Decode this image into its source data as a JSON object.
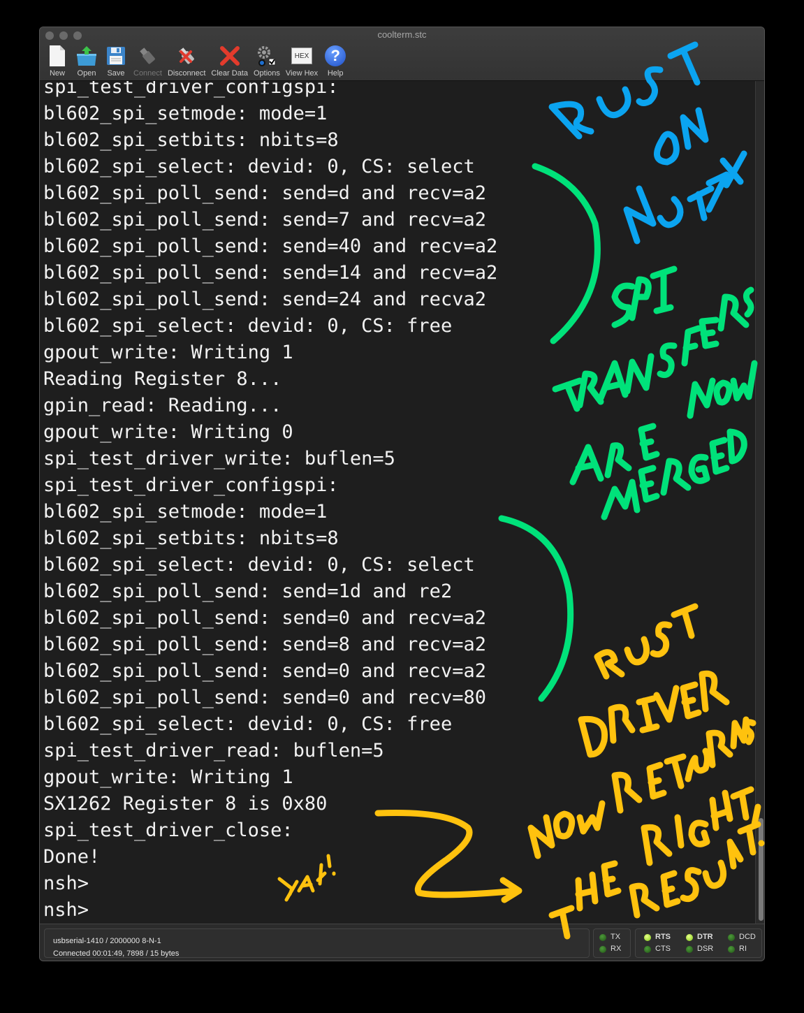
{
  "window": {
    "title": "coolterm.stc"
  },
  "toolbar": {
    "items": [
      {
        "label": "New",
        "icon": "new-file-icon",
        "enabled": true
      },
      {
        "label": "Open",
        "icon": "open-folder-icon",
        "enabled": true
      },
      {
        "label": "Save",
        "icon": "floppy-disk-icon",
        "enabled": true
      },
      {
        "label": "Connect",
        "icon": "usb-plug-icon",
        "enabled": false
      },
      {
        "label": "Disconnect",
        "icon": "disconnect-plug-icon",
        "enabled": true
      },
      {
        "label": "Clear Data",
        "icon": "red-x-icon",
        "enabled": true
      },
      {
        "label": "Options",
        "icon": "gears-icon",
        "enabled": true
      },
      {
        "label": "View Hex",
        "icon": "hex-icon",
        "enabled": true
      },
      {
        "label": "Help",
        "icon": "question-mark-icon",
        "enabled": true
      }
    ],
    "hex_glyph": "HEX",
    "help_glyph": "?"
  },
  "terminal": {
    "lines": [
      "spi_test_driver_configspi:",
      "bl602_spi_setmode: mode=1",
      "bl602_spi_setbits: nbits=8",
      "bl602_spi_select: devid: 0, CS: select",
      "bl602_spi_poll_send: send=d and recv=a2",
      "bl602_spi_poll_send: send=7 and recv=a2",
      "bl602_spi_poll_send: send=40 and recv=a2",
      "bl602_spi_poll_send: send=14 and recv=a2",
      "bl602_spi_poll_send: send=24 and recva2",
      "bl602_spi_select: devid: 0, CS: free",
      "gpout_write: Writing 1",
      "Reading Register 8...",
      "gpin_read: Reading...",
      "gpout_write: Writing 0",
      "spi_test_driver_write: buflen=5",
      "spi_test_driver_configspi:",
      "bl602_spi_setmode: mode=1",
      "bl602_spi_setbits: nbits=8",
      "bl602_spi_select: devid: 0, CS: select",
      "bl602_spi_poll_send: send=1d and re2",
      "bl602_spi_poll_send: send=0 and recv=a2",
      "bl602_spi_poll_send: send=8 and recv=a2",
      "bl602_spi_poll_send: send=0 and recv=a2",
      "bl602_spi_poll_send: send=0 and recv=80",
      "bl602_spi_select: devid: 0, CS: free",
      "spi_test_driver_read: buflen=5",
      "gpout_write: Writing 1",
      "SX1262 Register 8 is 0x80",
      "spi_test_driver_close:",
      "Done!",
      "nsh>",
      "nsh>"
    ],
    "scroll_position_fraction": 1.0
  },
  "status": {
    "port_settings": "usbserial-1410 / 2000000 8-N-1",
    "connection": "Connected 00:01:49, 7898 / 15 bytes",
    "tx_label": "TX",
    "rx_label": "RX",
    "signals": [
      {
        "label": "RTS",
        "on": true
      },
      {
        "label": "DTR",
        "on": true
      },
      {
        "label": "DCD",
        "on": false
      },
      {
        "label": "CTS",
        "on": false
      },
      {
        "label": "DSR",
        "on": false
      },
      {
        "label": "RI",
        "on": false
      }
    ]
  },
  "annotations": {
    "colors": {
      "blue": "#0ba4f0",
      "green": "#00e27a",
      "yellow": "#ffc20e"
    },
    "blue_text": [
      "RUST",
      "ON",
      "NUTTX"
    ],
    "green_text": [
      "SPI",
      "TRANSFERS",
      "ARE NOW",
      "MERGED"
    ],
    "yellow_text": [
      "RUST",
      "DRIVER",
      "NOW RETURNS",
      "THE RIGHT",
      "RESULT!"
    ],
    "yay_text": "YAY!"
  }
}
